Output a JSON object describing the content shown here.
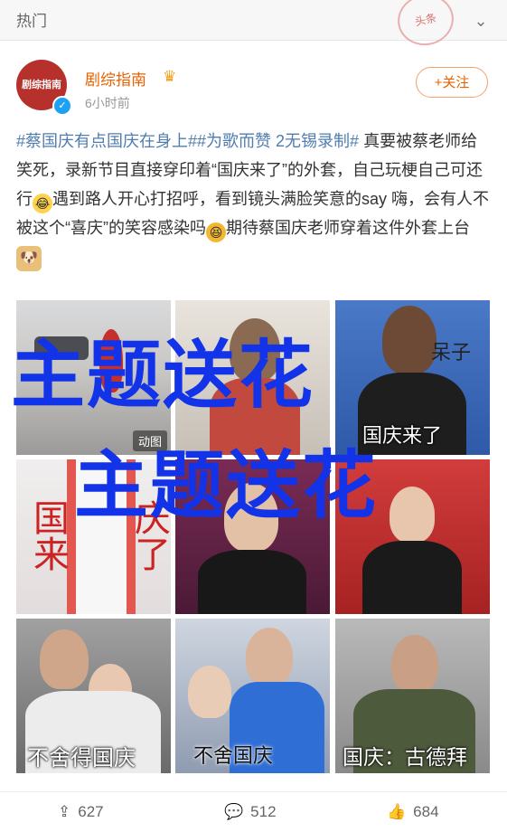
{
  "header": {
    "title": "热门"
  },
  "stamp_text": "头条",
  "post": {
    "author": "剧综指南",
    "avatar_text": "剧综指南",
    "time": "6小时前",
    "follow_label": "+关注",
    "hashtags": [
      "#蔡国庆有点国庆在身上#",
      "#为歌而赞 2无锡录制#"
    ],
    "text_1": " 真要被蔡老师给笑死，录新节目直接穿印着“国庆来了”的外套，自己玩梗自己可还行",
    "text_2": "遇到路人开心打招呼，看到镜头满脸笑意的say 嗨，会有人不被这个“喜庆”的笑容感染吗",
    "text_3": "期待蔡国庆老师穿着这件外套上台"
  },
  "images": [
    {
      "caption": "",
      "badge": "动图"
    },
    {
      "caption": "",
      "badge": ""
    },
    {
      "caption_top": "呆子",
      "caption_bottom": "国庆来了"
    },
    {
      "caption_left": "国来",
      "caption_right": "庆了"
    },
    {
      "caption": ""
    },
    {
      "caption": ""
    },
    {
      "caption": "不舍得国庆"
    },
    {
      "caption": "不舍国庆"
    },
    {
      "caption": "国庆：古德拜"
    }
  ],
  "overlay": {
    "line1": "主题送花",
    "line2": "主题送花"
  },
  "actions": {
    "reposts": "627",
    "comments": "512",
    "likes": "684"
  },
  "colors": {
    "accent": "#e86100",
    "hashtag": "#507daf",
    "overlay": "#1233e8"
  }
}
